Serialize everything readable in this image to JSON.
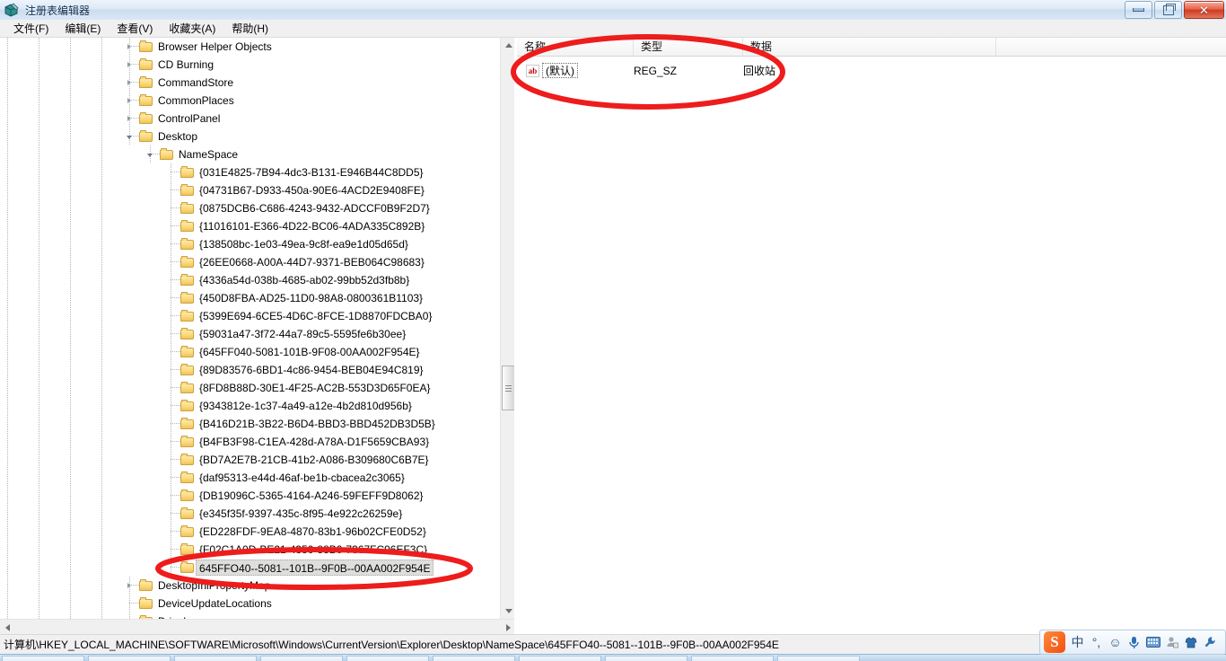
{
  "window": {
    "title": "注册表编辑器",
    "app_icon": "registry-editor-icon",
    "buttons": {
      "minimize": "–",
      "maximize": "❐",
      "close": "✕"
    }
  },
  "menu": {
    "items": [
      {
        "label": "文件(F)",
        "name": "menu-file"
      },
      {
        "label": "编辑(E)",
        "name": "menu-edit"
      },
      {
        "label": "查看(V)",
        "name": "menu-view"
      },
      {
        "label": "收藏夹(A)",
        "name": "menu-favorites"
      },
      {
        "label": "帮助(H)",
        "name": "menu-help"
      }
    ]
  },
  "tree": {
    "rows": [
      {
        "label": "Browser Helper Objects",
        "indent": 0,
        "twist": "closed",
        "selected": false
      },
      {
        "label": "CD Burning",
        "indent": 0,
        "twist": "closed",
        "selected": false
      },
      {
        "label": "CommandStore",
        "indent": 0,
        "twist": "closed",
        "selected": false
      },
      {
        "label": "CommonPlaces",
        "indent": 0,
        "twist": "closed",
        "selected": false
      },
      {
        "label": "ControlPanel",
        "indent": 0,
        "twist": "closed",
        "selected": false
      },
      {
        "label": "Desktop",
        "indent": 0,
        "twist": "open",
        "selected": false
      },
      {
        "label": "NameSpace",
        "indent": 1,
        "twist": "open",
        "selected": false
      },
      {
        "label": "{031E4825-7B94-4dc3-B131-E946B44C8DD5}",
        "indent": 2,
        "twist": "none",
        "selected": false
      },
      {
        "label": "{04731B67-D933-450a-90E6-4ACD2E9408FE}",
        "indent": 2,
        "twist": "none",
        "selected": false
      },
      {
        "label": "{0875DCB6-C686-4243-9432-ADCCF0B9F2D7}",
        "indent": 2,
        "twist": "none",
        "selected": false
      },
      {
        "label": "{11016101-E366-4D22-BC06-4ADA335C892B}",
        "indent": 2,
        "twist": "none",
        "selected": false
      },
      {
        "label": "{138508bc-1e03-49ea-9c8f-ea9e1d05d65d}",
        "indent": 2,
        "twist": "none",
        "selected": false
      },
      {
        "label": "{26EE0668-A00A-44D7-9371-BEB064C98683}",
        "indent": 2,
        "twist": "none",
        "selected": false
      },
      {
        "label": "{4336a54d-038b-4685-ab02-99bb52d3fb8b}",
        "indent": 2,
        "twist": "none",
        "selected": false
      },
      {
        "label": "{450D8FBA-AD25-11D0-98A8-0800361B1103}",
        "indent": 2,
        "twist": "none",
        "selected": false
      },
      {
        "label": "{5399E694-6CE5-4D6C-8FCE-1D8870FDCBA0}",
        "indent": 2,
        "twist": "none",
        "selected": false
      },
      {
        "label": "{59031a47-3f72-44a7-89c5-5595fe6b30ee}",
        "indent": 2,
        "twist": "none",
        "selected": false
      },
      {
        "label": "{645FF040-5081-101B-9F08-00AA002F954E}",
        "indent": 2,
        "twist": "none",
        "selected": false
      },
      {
        "label": "{89D83576-6BD1-4c86-9454-BEB04E94C819}",
        "indent": 2,
        "twist": "none",
        "selected": false
      },
      {
        "label": "{8FD8B88D-30E1-4F25-AC2B-553D3D65F0EA}",
        "indent": 2,
        "twist": "none",
        "selected": false
      },
      {
        "label": "{9343812e-1c37-4a49-a12e-4b2d810d956b}",
        "indent": 2,
        "twist": "none",
        "selected": false
      },
      {
        "label": "{B416D21B-3B22-B6D4-BBD3-BBD452DB3D5B}",
        "indent": 2,
        "twist": "none",
        "selected": false
      },
      {
        "label": "{B4FB3F98-C1EA-428d-A78A-D1F5659CBA93}",
        "indent": 2,
        "twist": "none",
        "selected": false
      },
      {
        "label": "{BD7A2E7B-21CB-41b2-A086-B309680C6B7E}",
        "indent": 2,
        "twist": "none",
        "selected": false
      },
      {
        "label": "{daf95313-e44d-46af-be1b-cbacea2c3065}",
        "indent": 2,
        "twist": "none",
        "selected": false
      },
      {
        "label": "{DB19096C-5365-4164-A246-59FEFF9D8062}",
        "indent": 2,
        "twist": "none",
        "selected": false
      },
      {
        "label": "{e345f35f-9397-435c-8f95-4e922c26259e}",
        "indent": 2,
        "twist": "none",
        "selected": false
      },
      {
        "label": "{ED228FDF-9EA8-4870-83b1-96b02CFE0D52}",
        "indent": 2,
        "twist": "none",
        "selected": false
      },
      {
        "label": "{F02C1A0D-BE21-4350-88B0-7367FC96EF3C}",
        "indent": 2,
        "twist": "none",
        "selected": false
      },
      {
        "label": "645FFO40--5081--101B--9F0B--00AA002F954E",
        "indent": 2,
        "twist": "none",
        "selected": true
      },
      {
        "label": "DesktopIniPropertyMap",
        "indent": 0,
        "twist": "closed",
        "selected": false
      },
      {
        "label": "DeviceUpdateLocations",
        "indent": 0,
        "twist": "none",
        "selected": false
      },
      {
        "label": "DriveIcons",
        "indent": 0,
        "twist": "none",
        "selected": false
      }
    ]
  },
  "values": {
    "columns": [
      {
        "label": "名称",
        "name": "column-name"
      },
      {
        "label": "类型",
        "name": "column-type"
      },
      {
        "label": "数据",
        "name": "column-data"
      }
    ],
    "rows": [
      {
        "icon": "string-value-icon",
        "name": "(默认)",
        "type": "REG_SZ",
        "data": "回收站"
      }
    ]
  },
  "statusbar": {
    "path": "计算机\\HKEY_LOCAL_MACHINE\\SOFTWARE\\Microsoft\\Windows\\CurrentVersion\\Explorer\\Desktop\\NameSpace\\645FFO40--5081--101B--9F0B--00AA002F954E"
  },
  "annotations": {
    "ellipse_values": {
      "name": "red-ellipse-values-row",
      "color": "#ee1c1c"
    },
    "ellipse_tree": {
      "name": "red-ellipse-selected-key",
      "color": "#ee1c1c"
    }
  },
  "ime": {
    "logo": "sogou-logo-icon",
    "icons": [
      {
        "glyph": "中",
        "name": "ime-chinese-mode-icon"
      },
      {
        "glyph": "°,",
        "name": "ime-punctuation-icon"
      },
      {
        "glyph": "☺",
        "name": "ime-emoji-icon"
      },
      {
        "glyph": "ⵔ",
        "name": "ime-voice-input-icon"
      },
      {
        "glyph": "⌨",
        "name": "ime-soft-keyboard-icon"
      },
      {
        "glyph": "⛮",
        "name": "ime-user-icon"
      },
      {
        "glyph": "☂",
        "name": "ime-skin-icon"
      },
      {
        "glyph": "⚒",
        "name": "ime-settings-icon"
      }
    ]
  },
  "taskbar": {
    "buttons": [
      {
        "name": "taskbar-start-button"
      },
      {
        "name": "taskbar-item-1"
      },
      {
        "name": "taskbar-item-2"
      },
      {
        "name": "taskbar-item-3"
      },
      {
        "name": "taskbar-item-4"
      },
      {
        "name": "taskbar-item-5"
      },
      {
        "name": "taskbar-item-6"
      },
      {
        "name": "taskbar-item-7"
      },
      {
        "name": "taskbar-item-8"
      },
      {
        "name": "taskbar-item-9"
      }
    ]
  }
}
